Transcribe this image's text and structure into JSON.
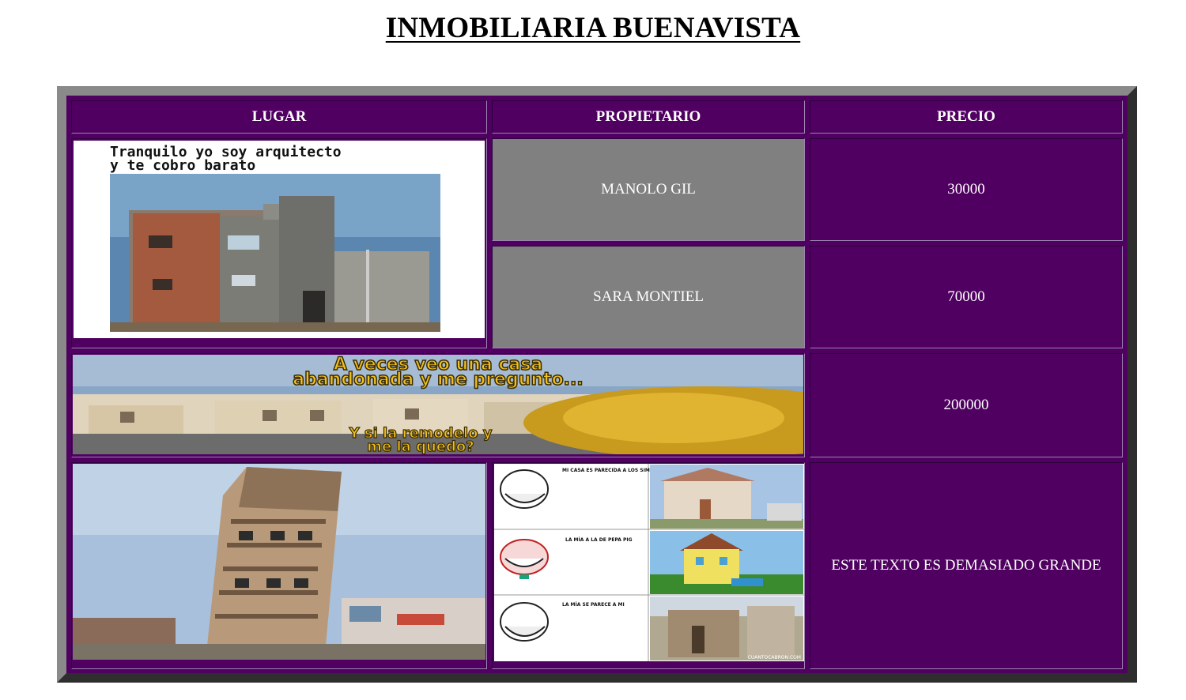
{
  "page": {
    "title": "INMOBILIARIA BUENAVISTA"
  },
  "table": {
    "headers": [
      "LUGAR",
      "PROPIETARIO",
      "PRECIO"
    ],
    "rows": [
      {
        "propietario": "MANOLO GIL",
        "precio": "30000"
      },
      {
        "propietario": "SARA MONTIEL",
        "precio": "70000"
      },
      {
        "precio": "200000"
      },
      {
        "precio": "ESTE TEXTO ES DEMASIADO GRANDE"
      }
    ]
  },
  "images": {
    "building1_caption": [
      "Tranquilo yo soy arquitecto",
      "y te cobro barato"
    ],
    "abandoned_caption_top": [
      "A veces veo una casa",
      "abandonada y me pregunto..."
    ],
    "abandoned_caption_bottom": [
      "Y si la remodelo y",
      "me la quedo?"
    ],
    "comic_captions": [
      "MI CASA ES PARECIDA A LOS SIMPSONS",
      "LA MÍA A LA DE PEPA PIG",
      "LA MÍA SE PARECE A MI"
    ],
    "comic_watermark": "CUANTOCABRON.COM"
  },
  "colors": {
    "table_bg": "#4f0060",
    "owner_cell_bg": "#808080",
    "frame_light": "#8a8a8a",
    "frame_dark": "#2e2e2e"
  }
}
